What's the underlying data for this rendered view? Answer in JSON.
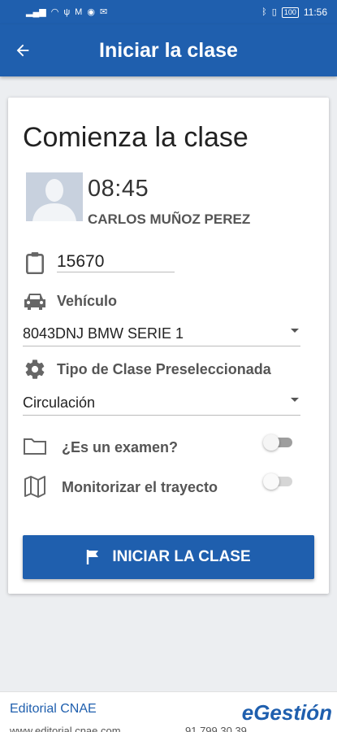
{
  "status_bar": {
    "time": "11:56",
    "battery": "100",
    "left_icons": [
      "signal-icon",
      "wifi-icon",
      "usb-icon",
      "gmail-icon",
      "alert-icon",
      "mail-icon"
    ],
    "right_icons": [
      "bluetooth-icon",
      "vibrate-icon",
      "battery-icon"
    ]
  },
  "app_bar": {
    "title": "Iniciar la clase",
    "back_icon": "back-arrow-icon"
  },
  "card": {
    "title": "Comienza la clase",
    "time": "08:45",
    "student_name": "CARLOS MUÑOZ PEREZ",
    "code": "15670",
    "vehicle_label": "Vehículo",
    "vehicle_selected": "8043DNJ BMW SERIE 1",
    "class_type_label": "Tipo de Clase Preseleccionada",
    "class_type_selected": "Circulación",
    "exam_label": "¿Es un examen?",
    "exam_toggle_on": false,
    "monitor_label": "Monitorizar el trayecto",
    "monitor_toggle_on": false,
    "start_button_label": "INICIAR LA CLASE"
  },
  "footer": {
    "company": "Editorial CNAE",
    "website": "www.editorial.cnae.com",
    "phone": "91 799 30 39",
    "logo": "eGestión"
  },
  "colors": {
    "primary": "#1f5fae",
    "background": "#eceef1",
    "text_gray": "#555555"
  }
}
